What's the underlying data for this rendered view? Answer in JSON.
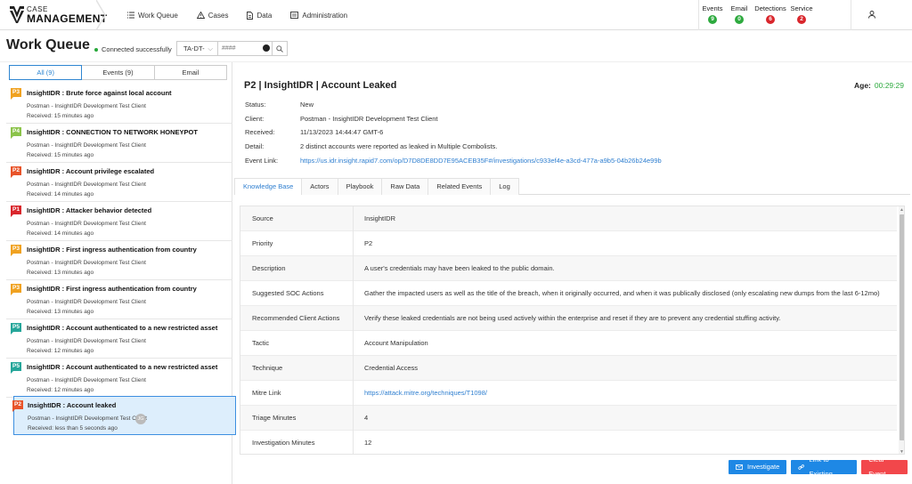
{
  "app": {
    "brand_top": "CASE",
    "brand_bottom": "MANAGEMENT"
  },
  "nav": [
    {
      "label": "Work Queue",
      "icon": "list-icon"
    },
    {
      "label": "Cases",
      "icon": "warning-icon"
    },
    {
      "label": "Data",
      "icon": "document-icon"
    },
    {
      "label": "Administration",
      "icon": "admin-icon"
    }
  ],
  "stats": [
    {
      "label": "Events",
      "count": "9",
      "color": "#2eaa3f"
    },
    {
      "label": "Email",
      "count": "0",
      "color": "#2eaa3f"
    },
    {
      "label": "Detections",
      "count": "6",
      "color": "#d9262c"
    },
    {
      "label": "Service",
      "count": "2",
      "color": "#d9262c"
    }
  ],
  "page": {
    "title": "Work Queue",
    "connection": "Connected successfully",
    "filter_select": "TA-DT-",
    "filter_placeholder": "####"
  },
  "tabs": [
    {
      "label": "All (9)",
      "active": true
    },
    {
      "label": "Events (9)",
      "active": false
    },
    {
      "label": "Email",
      "active": false
    }
  ],
  "queue": [
    {
      "priority": "P3",
      "color": "#f0a221",
      "title": "InsightIDR : Brute force against local account",
      "client": "Postman - InsightIDR Development Test Client",
      "received": "Received: 15 minutes ago"
    },
    {
      "priority": "P4",
      "color": "#8bc34a",
      "title": "InsightIDR : CONNECTION TO NETWORK HONEYPOT",
      "client": "Postman - InsightIDR Development Test Client",
      "received": "Received: 15 minutes ago"
    },
    {
      "priority": "P2",
      "color": "#e8542a",
      "title": "InsightIDR : Account privilege escalated",
      "client": "Postman - InsightIDR Development Test Client",
      "received": "Received: 14 minutes ago"
    },
    {
      "priority": "P1",
      "color": "#d9262c",
      "title": "InsightIDR : Attacker behavior detected",
      "client": "Postman - InsightIDR Development Test Client",
      "received": "Received: 14 minutes ago"
    },
    {
      "priority": "P3",
      "color": "#f0a221",
      "title": "InsightIDR : First ingress authentication from country",
      "client": "Postman - InsightIDR Development Test Client",
      "received": "Received: 13 minutes ago"
    },
    {
      "priority": "P3",
      "color": "#f0a221",
      "title": "InsightIDR : First ingress authentication from country",
      "client": "Postman - InsightIDR Development Test Client",
      "received": "Received: 13 minutes ago"
    },
    {
      "priority": "P5",
      "color": "#26a69a",
      "title": "InsightIDR : Account authenticated to a new restricted asset",
      "client": "Postman - InsightIDR Development Test Client",
      "received": "Received: 12 minutes ago"
    },
    {
      "priority": "P5",
      "color": "#26a69a",
      "title": "InsightIDR : Account authenticated to a new restricted asset",
      "client": "Postman - InsightIDR Development Test Client",
      "received": "Received: 12 minutes ago"
    },
    {
      "priority": "P2",
      "color": "#e8542a",
      "title": "InsightIDR : Account leaked",
      "client": "Postman - InsightIDR Development Test Client",
      "received": "Received: less than 5 seconds ago",
      "avatar": "JG",
      "selected": true
    }
  ],
  "detail": {
    "title": "P2 | InsightIDR | Account Leaked",
    "age_label": "Age:",
    "age_value": "00:29:29",
    "fields": [
      {
        "label": "Status:",
        "value": "New"
      },
      {
        "label": "Client:",
        "value": "Postman - InsightIDR Development Test Client"
      },
      {
        "label": "Received:",
        "value": "11/13/2023 14:44:47 GMT-6"
      },
      {
        "label": "Detail:",
        "value": "2 distinct accounts were reported as leaked in Multiple Combolists."
      },
      {
        "label": "Event Link:",
        "value": "https://us.idr.insight.rapid7.com/op/D7D8DE8DD7E95ACEB35F#/investigations/c933ef4e-a3cd-477a-a9b5-04b26b24e99b",
        "link": true
      }
    ],
    "tabs": [
      "Knowledge Base",
      "Actors",
      "Playbook",
      "Raw Data",
      "Related Events",
      "Log"
    ],
    "knowledge_base": [
      {
        "key": "Source",
        "value": "InsightIDR"
      },
      {
        "key": "Priority",
        "value": "P2"
      },
      {
        "key": "Description",
        "value": "A user's credentials may have been leaked to the public domain."
      },
      {
        "key": "Suggested SOC Actions",
        "value": "Gather the impacted users as well as the title of the breach, when it originally occurred, and when it was publically disclosed (only escalating new dumps from the last 6-12mo)"
      },
      {
        "key": "Recommended Client Actions",
        "value": "Verify these leaked credentials are not being used actively within the enterprise and reset if they are to prevent any credential stuffing activity."
      },
      {
        "key": "Tactic",
        "value": "Account Manipulation"
      },
      {
        "key": "Technique",
        "value": "Credential Access"
      },
      {
        "key": "Mitre Link",
        "value": "https://attack.mitre.org/techniques/T1098/",
        "link": true
      },
      {
        "key": "Triage Minutes",
        "value": "4"
      },
      {
        "key": "Investigation Minutes",
        "value": "12"
      }
    ],
    "buttons": [
      {
        "label": "Investigate",
        "color": "#1e88e5",
        "icon": "envelope-icon"
      },
      {
        "label": "Link to Existing",
        "color": "#1e88e5",
        "icon": "link-icon"
      },
      {
        "label": "Clear Event",
        "color": "#f2474b"
      }
    ]
  }
}
